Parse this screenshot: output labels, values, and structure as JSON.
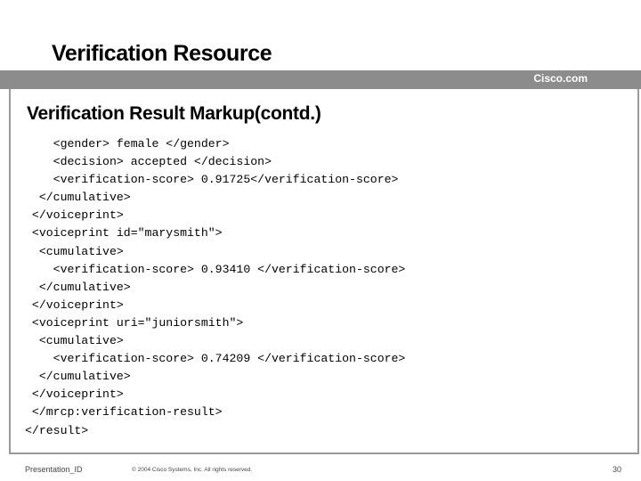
{
  "slide": {
    "title": "Verification Resource",
    "brand": "Cisco.com",
    "subtitle": "Verification Result Markup(contd.)"
  },
  "code_lines": [
    {
      "indent": "    ",
      "text": "<gender> female </gender>"
    },
    {
      "indent": "    ",
      "text": "<decision> accepted </decision>"
    },
    {
      "indent": "    ",
      "text": "<verification-score> 0.91725</verification-score>"
    },
    {
      "indent": "  ",
      "text": "</cumulative>"
    },
    {
      "indent": " ",
      "text": "</voiceprint>"
    },
    {
      "indent": " ",
      "text": "<voiceprint id=\"marysmith\">"
    },
    {
      "indent": "  ",
      "text": "<cumulative>"
    },
    {
      "indent": "    ",
      "text": "<verification-score> 0.93410 </verification-score>"
    },
    {
      "indent": "  ",
      "text": "</cumulative>"
    },
    {
      "indent": " ",
      "text": "</voiceprint>"
    },
    {
      "indent": " ",
      "text": "<voiceprint uri=\"juniorsmith\">"
    },
    {
      "indent": "  ",
      "text": "<cumulative>"
    },
    {
      "indent": "    ",
      "text": "<verification-score> 0.74209 </verification-score>"
    },
    {
      "indent": "  ",
      "text": "</cumulative>"
    },
    {
      "indent": " ",
      "text": "</voiceprint>"
    },
    {
      "indent": "",
      "text": " </mrcp:verification-result>"
    },
    {
      "indent": "",
      "text": "</result>"
    }
  ],
  "footer": {
    "left": "Presentation_ID",
    "center": "© 2004 Cisco Systems, Inc. All rights reserved.",
    "page": "30"
  }
}
